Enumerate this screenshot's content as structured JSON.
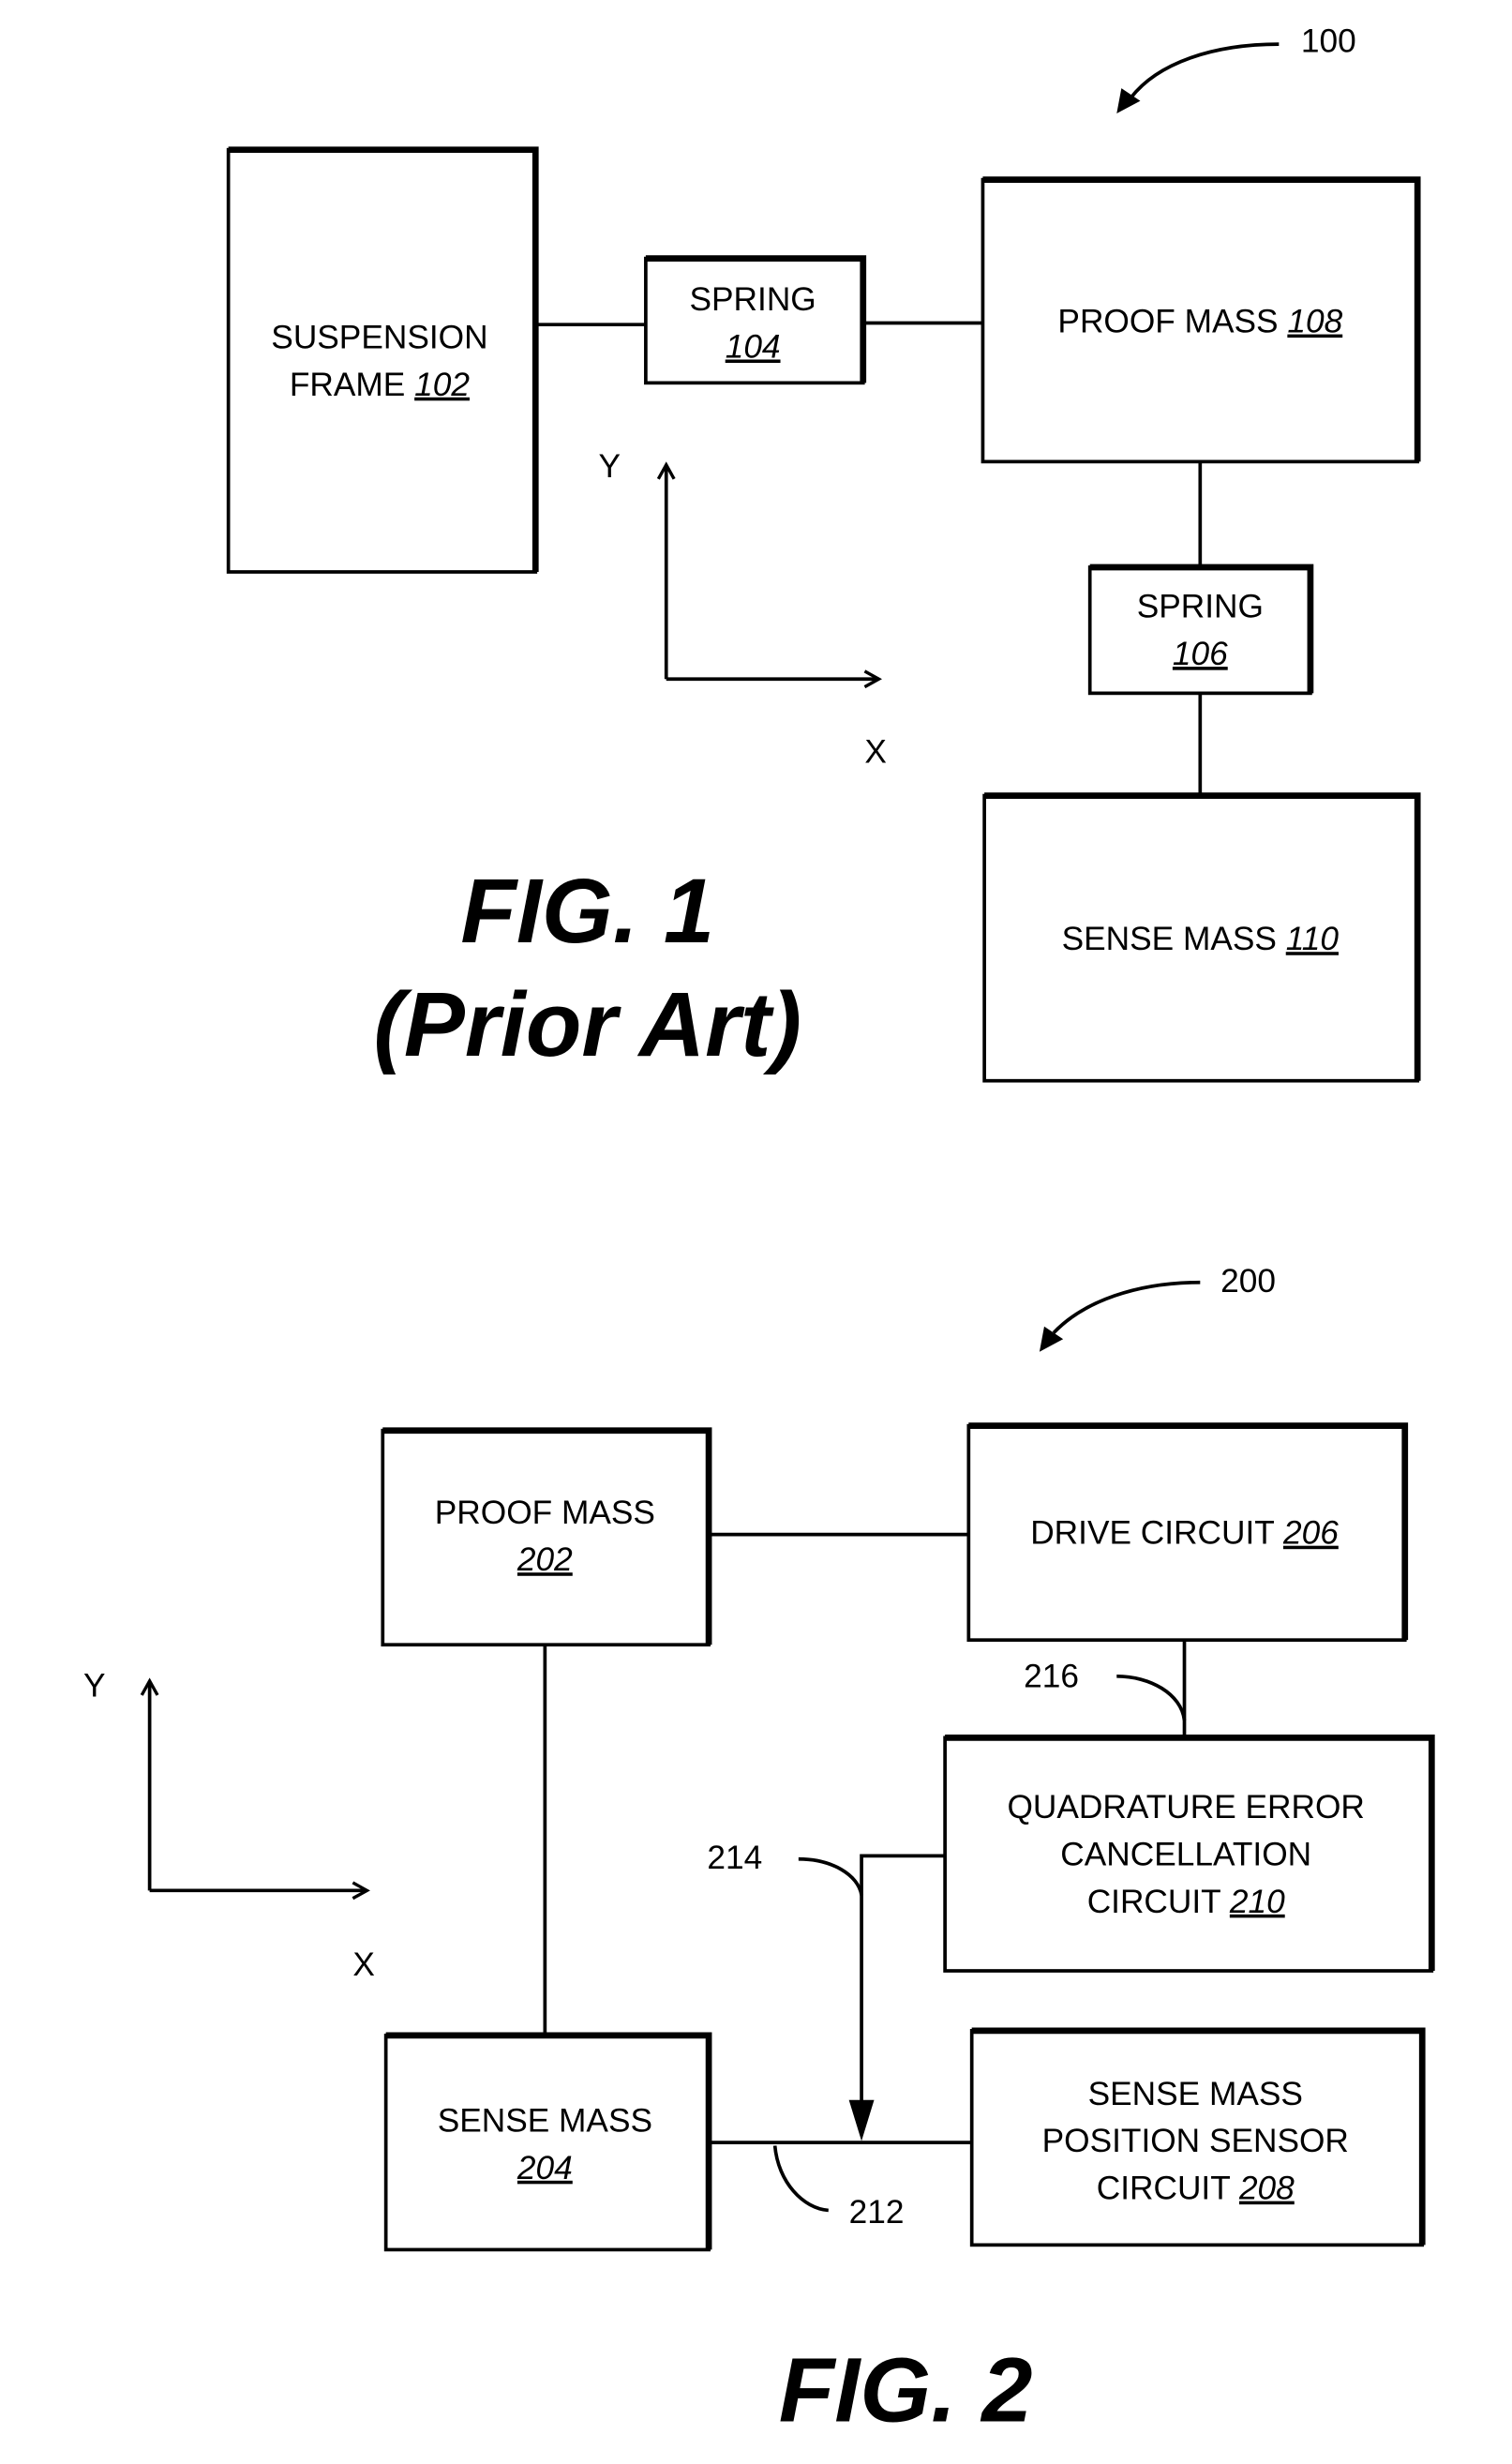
{
  "figure1": {
    "reference": "100",
    "title": "FIG. 1",
    "subtitle": "(Prior Art)",
    "blocks": {
      "suspension_frame": {
        "line1": "SUSPENSION",
        "line2": "FRAME ",
        "ref": "102"
      },
      "spring_104": {
        "line1": "SPRING",
        "ref": "104"
      },
      "proof_mass": {
        "line1": "PROOF MASS ",
        "ref": "108"
      },
      "spring_106": {
        "line1": "SPRING",
        "ref": "106"
      },
      "sense_mass": {
        "line1": "SENSE MASS ",
        "ref": "110"
      }
    },
    "axes": {
      "y_label": "Y",
      "x_label": "X"
    }
  },
  "figure2": {
    "reference": "200",
    "title": "FIG. 2",
    "blocks": {
      "proof_mass": {
        "line1": "PROOF MASS",
        "ref": "202"
      },
      "drive_circuit": {
        "line1": "DRIVE CIRCUIT ",
        "ref": "206"
      },
      "quadrature": {
        "line1": "QUADRATURE ERROR",
        "line2": "CANCELLATION",
        "line3": "CIRCUIT ",
        "ref": "210"
      },
      "sense_mass": {
        "line1": "SENSE MASS",
        "ref": "204"
      },
      "position_sensor": {
        "line1": "SENSE MASS",
        "line2": "POSITION SENSOR",
        "line3": "CIRCUIT ",
        "ref": "208"
      }
    },
    "signals": {
      "s212": "212",
      "s214": "214",
      "s216": "216"
    },
    "axes": {
      "y_label": "Y",
      "x_label": "X"
    }
  }
}
